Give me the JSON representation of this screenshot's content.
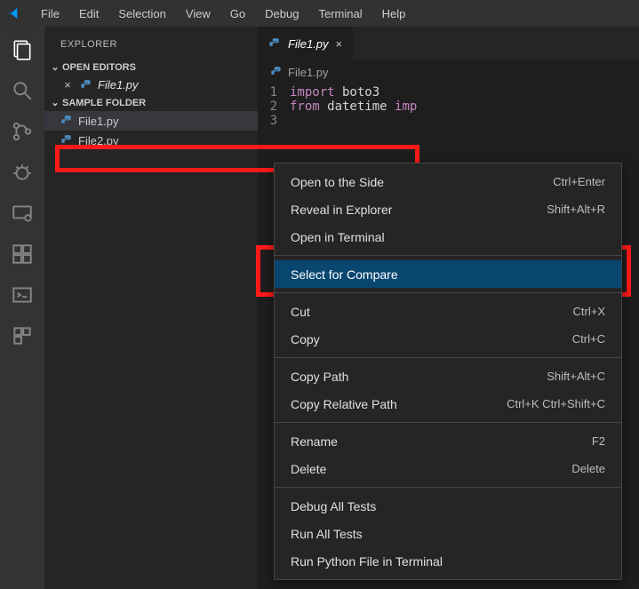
{
  "menubar": [
    "File",
    "Edit",
    "Selection",
    "View",
    "Go",
    "Debug",
    "Terminal",
    "Help"
  ],
  "sidebar": {
    "title": "Explorer",
    "openEditorsHeader": "Open Editors",
    "openEditors": [
      {
        "name": "File1.py"
      }
    ],
    "folderName": "Sample Folder",
    "files": [
      {
        "name": "File1.py",
        "selected": true
      },
      {
        "name": "File2.py",
        "selected": false
      }
    ]
  },
  "tab": {
    "name": "File1.py"
  },
  "breadcrumb": "File1.py",
  "code": {
    "lines": [
      {
        "n": "1",
        "t1": "import",
        "t2": " boto3"
      },
      {
        "n": "2",
        "t1": "from",
        "t2": " datetime ",
        "t3": "imp"
      },
      {
        "n": "3",
        "t1": "",
        "t2": ""
      }
    ]
  },
  "contextMenu": [
    {
      "label": "Open to the Side",
      "shortcut": "Ctrl+Enter"
    },
    {
      "label": "Reveal in Explorer",
      "shortcut": "Shift+Alt+R"
    },
    {
      "label": "Open in Terminal",
      "shortcut": ""
    },
    {
      "sep": true
    },
    {
      "label": "Select for Compare",
      "shortcut": "",
      "hover": true
    },
    {
      "sep": true
    },
    {
      "label": "Cut",
      "shortcut": "Ctrl+X"
    },
    {
      "label": "Copy",
      "shortcut": "Ctrl+C"
    },
    {
      "sep": true
    },
    {
      "label": "Copy Path",
      "shortcut": "Shift+Alt+C"
    },
    {
      "label": "Copy Relative Path",
      "shortcut": "Ctrl+K Ctrl+Shift+C"
    },
    {
      "sep": true
    },
    {
      "label": "Rename",
      "shortcut": "F2"
    },
    {
      "label": "Delete",
      "shortcut": "Delete"
    },
    {
      "sep": true
    },
    {
      "label": "Debug All Tests",
      "shortcut": ""
    },
    {
      "label": "Run All Tests",
      "shortcut": ""
    },
    {
      "label": "Run Python File in Terminal",
      "shortcut": ""
    }
  ]
}
